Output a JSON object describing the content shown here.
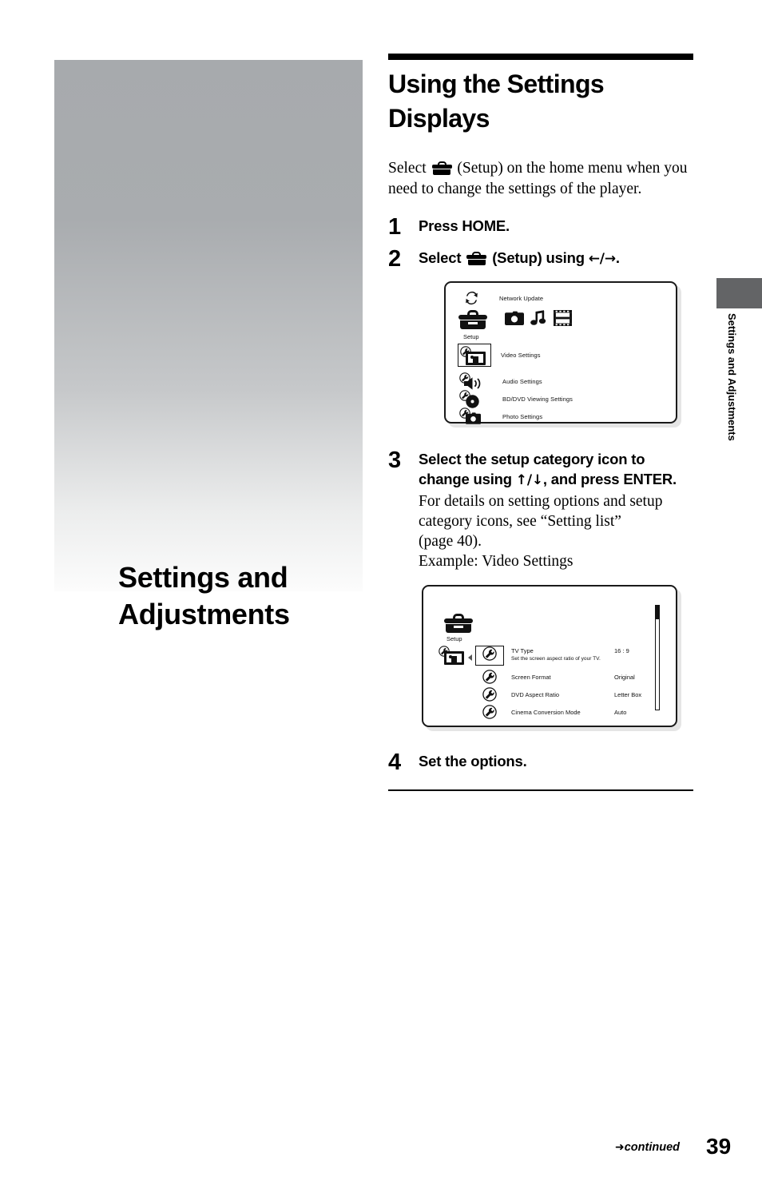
{
  "chapter": {
    "title": "Settings and\nAdjustments",
    "side_tab_label": "Settings and Adjustments"
  },
  "heading": "Using the Settings Displays",
  "intro": {
    "before_icon": "Select",
    "icon": "toolbox-setup-icon",
    "after_icon": "(Setup) on the home menu when you need to change the settings of the player."
  },
  "steps": [
    {
      "number": "1",
      "head": "Press HOME.",
      "sub": ""
    },
    {
      "number": "2",
      "head_before": "Select",
      "head_icon": "toolbox-setup-icon",
      "head_after": "(Setup) using",
      "head_keys": "←/→",
      "head_end": "."
    },
    {
      "number": "3",
      "head": "Select the setup category icon to change using ↑/↓, and press ENTER.",
      "head_part1": "Select the setup category icon to",
      "head_part2a": "change using",
      "head_keys": "↑/↓",
      "head_part2b": ", and press ENTER.",
      "sub_line1": "For details on setting options and setup",
      "sub_line2": "category icons, see “Setting list”",
      "sub_line3": "(page 40).",
      "sub_line4": "Example: Video Settings"
    },
    {
      "number": "4",
      "head": "Set the options.",
      "sub": ""
    }
  ],
  "osd_home": {
    "network_update": "Network Update",
    "setup_label": "Setup",
    "top_icons": [
      "toolbox-setup-icon",
      "camera-icon",
      "music-note-icon",
      "film-strip-icon"
    ],
    "categories": [
      {
        "icon": "wrench-video-icon",
        "label": "Video Settings",
        "selected": true
      },
      {
        "icon": "wrench-audio-icon",
        "label": "Audio Settings",
        "selected": false
      },
      {
        "icon": "wrench-disc-icon",
        "label": "BD/DVD Viewing Settings",
        "selected": false
      },
      {
        "icon": "wrench-photo-icon",
        "label": "Photo Settings",
        "selected": false
      }
    ]
  },
  "osd_video": {
    "setup_label": "Setup",
    "category_icon": "wrench-video-icon",
    "options": [
      {
        "name": "TV Type",
        "desc": "Set the screen aspect ratio of your TV.",
        "value": "16 : 9",
        "selected": true
      },
      {
        "name": "Screen Format",
        "desc": "",
        "value": "Original",
        "selected": false
      },
      {
        "name": "DVD Aspect Ratio",
        "desc": "",
        "value": "Letter Box",
        "selected": false
      },
      {
        "name": "Cinema Conversion Mode",
        "desc": "",
        "value": "Auto",
        "selected": false
      }
    ]
  },
  "footer": {
    "continued": "continued",
    "arrow": "➜",
    "page_number": "39"
  },
  "colors": {
    "ink": "#000000",
    "tab_gray": "#636466",
    "chapter_gradient_top": "#a7aaad",
    "chapter_gradient_bottom": "#fcfcfc"
  }
}
